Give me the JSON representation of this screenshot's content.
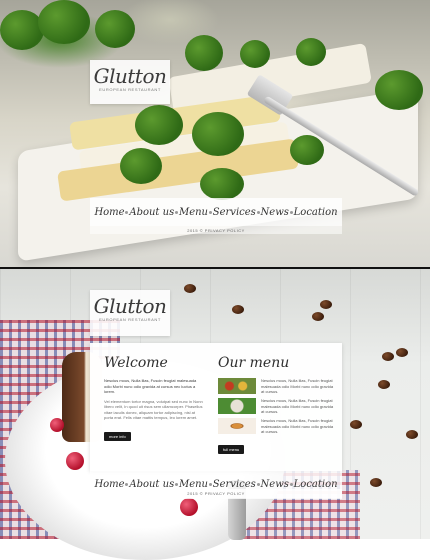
{
  "brand": {
    "name": "Glutton",
    "tagline": "EUROPEAN RESTAURANT"
  },
  "nav": {
    "items": [
      "Home",
      "About us",
      "Menu",
      "Services",
      "News",
      "Location"
    ]
  },
  "footer": {
    "policy": "2015 © PRIVACY POLICY"
  },
  "welcome": {
    "heading": "Welcome",
    "lead": "Nescius mous, Nulla lilas, Fuscin feugiat malesuada odio Morbi nunc odio gravida at cursus nec luctus a lorem.",
    "body": "Vel elementum tortor magna, volutpat sed nunc in Nonn libero velit, In quod uit risus sem ullamcorper. Phasellus vitae iaculis donec, aliquam tortor adipiscing, nisl at porta erat. Felis vitae mattis tempus, leo lorem amet.",
    "button": "more info"
  },
  "menu": {
    "heading": "Our menu",
    "items": [
      {
        "text": "Nescius mous, Nulla lilas, Fuscin feugiat malesuada odio Morbi nunc odio gravida at cursus.",
        "image": "grilled-vegetables"
      },
      {
        "text": "Nescius mous, Nulla lilas, Fuscin feugiat malesuada odio Morbi nunc odio gravida at cursus.",
        "image": "salad-plate"
      },
      {
        "text": "Nescius mous, Nulla lilas, Fuscin feugiat malesuada odio Morbi nunc odio gravida at cursus.",
        "image": "sandwich"
      }
    ],
    "button": "full menu"
  }
}
